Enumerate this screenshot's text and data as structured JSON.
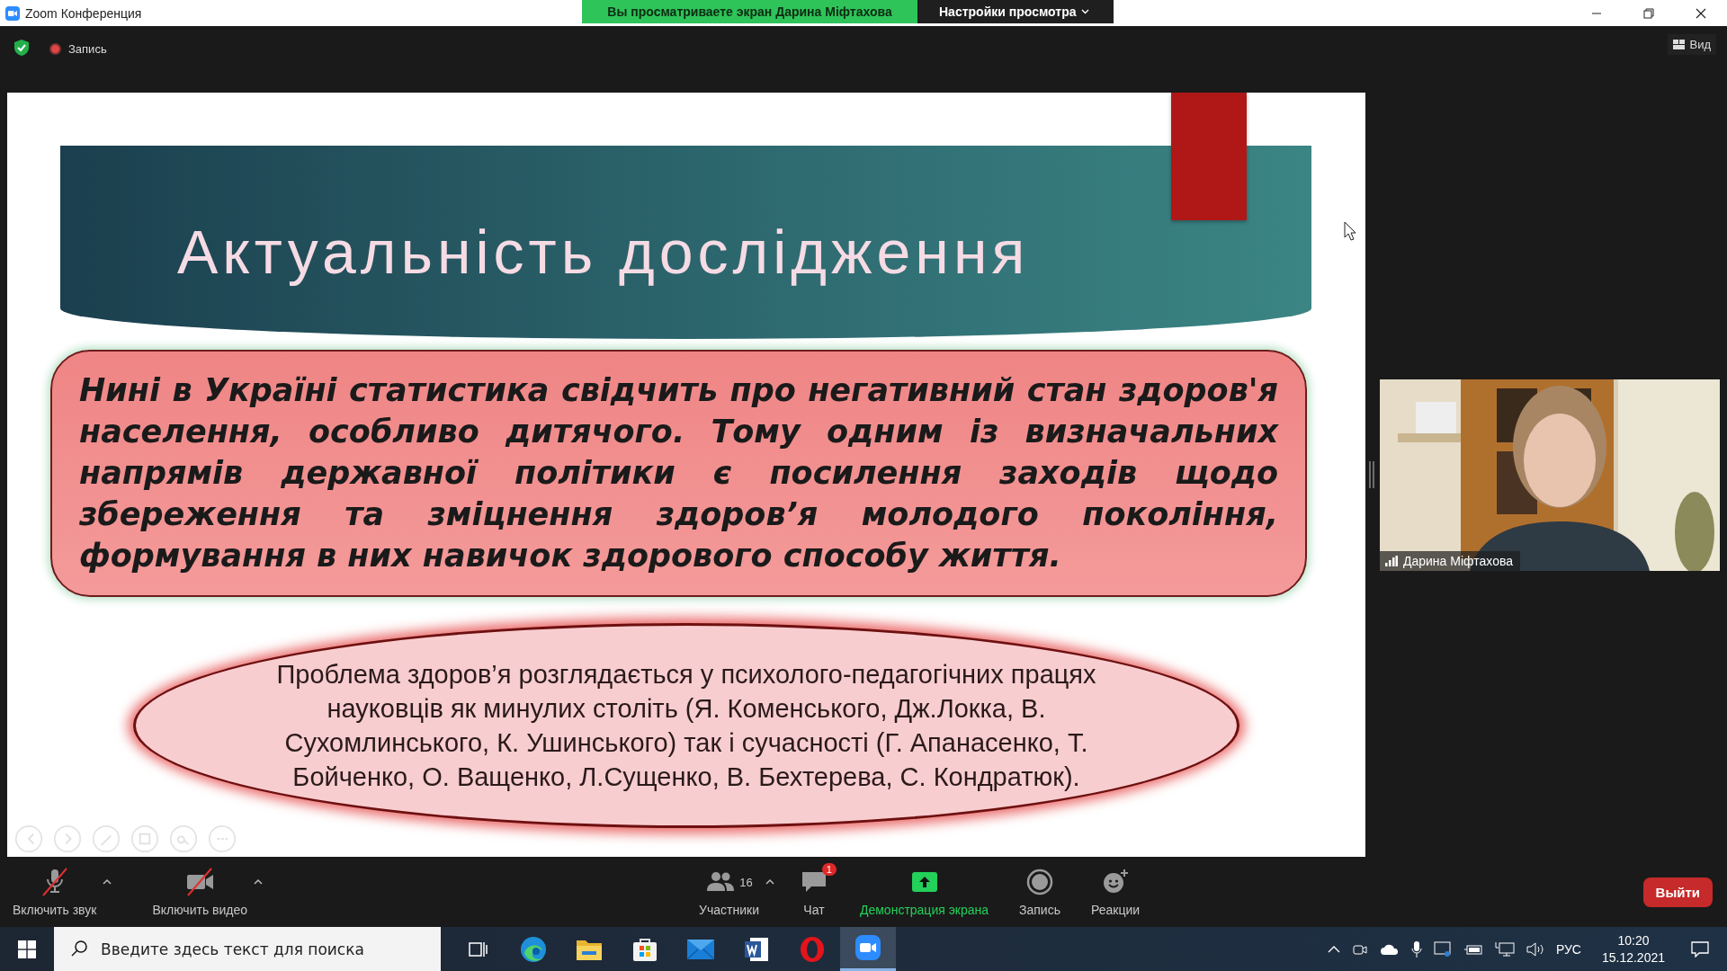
{
  "window": {
    "title": "Zoom Конференция"
  },
  "banner": {
    "viewing": "Вы просматриваете экран Дарина Міфтахова",
    "settings": "Настройки просмотра"
  },
  "meeting_bar": {
    "recording": "Запись",
    "view": "Вид"
  },
  "slide": {
    "title": "Актуальність дослідження",
    "paragraph": "Нині в Україні статистика свідчить про негативний стан здоров'я населення, особливо дитячого. Тому одним із визначальних напрямів державної політики є посилення заходів щодо збереження та зміцнення здоров’я молодого покоління, формування в них навичок здорового способу життя.",
    "quote": "Проблема здоров’я розглядається у психолого-педагогічних працях науковців як минулих століть (Я. Коменського, Дж.Локка, В. Сухомлинського, К. Ушинського) так і сучасності (Г. Апанасенко, Т. Бойченко, О. Ващенко, Л.Сущенко, В. Бехтерева, С. Кондратюк)."
  },
  "video": {
    "name": "Дарина Міфтахова"
  },
  "toolbar": {
    "items": [
      {
        "kind": "audio",
        "label": "Включить звук",
        "off": true,
        "menu": true
      },
      {
        "kind": "video",
        "label": "Включить видео",
        "off": true,
        "menu": true
      },
      {
        "kind": "participants",
        "label": "Участники",
        "count": "16",
        "off": false,
        "menu": true
      },
      {
        "kind": "chat",
        "label": "Чат",
        "badge": "1",
        "off": false,
        "menu": false
      },
      {
        "kind": "share",
        "label": "Демонстрация экрана",
        "off": false,
        "menu": false
      },
      {
        "kind": "record",
        "label": "Запись",
        "off": false,
        "menu": false
      },
      {
        "kind": "reactions",
        "label": "Реакции",
        "off": false,
        "menu": false
      }
    ],
    "leave": "Выйти"
  },
  "taskbar": {
    "search_placeholder": "Введите здесь текст для поиска",
    "apps": [
      {
        "kind": "taskview",
        "selected": false
      },
      {
        "kind": "edge",
        "selected": false
      },
      {
        "kind": "explorer",
        "selected": false
      },
      {
        "kind": "store",
        "selected": false
      },
      {
        "kind": "mail",
        "selected": false
      },
      {
        "kind": "word",
        "selected": false
      },
      {
        "kind": "opera",
        "selected": false
      },
      {
        "kind": "zoom",
        "selected": true
      }
    ],
    "language": "РУС",
    "time": "10:20",
    "date": "15.12.2021"
  }
}
